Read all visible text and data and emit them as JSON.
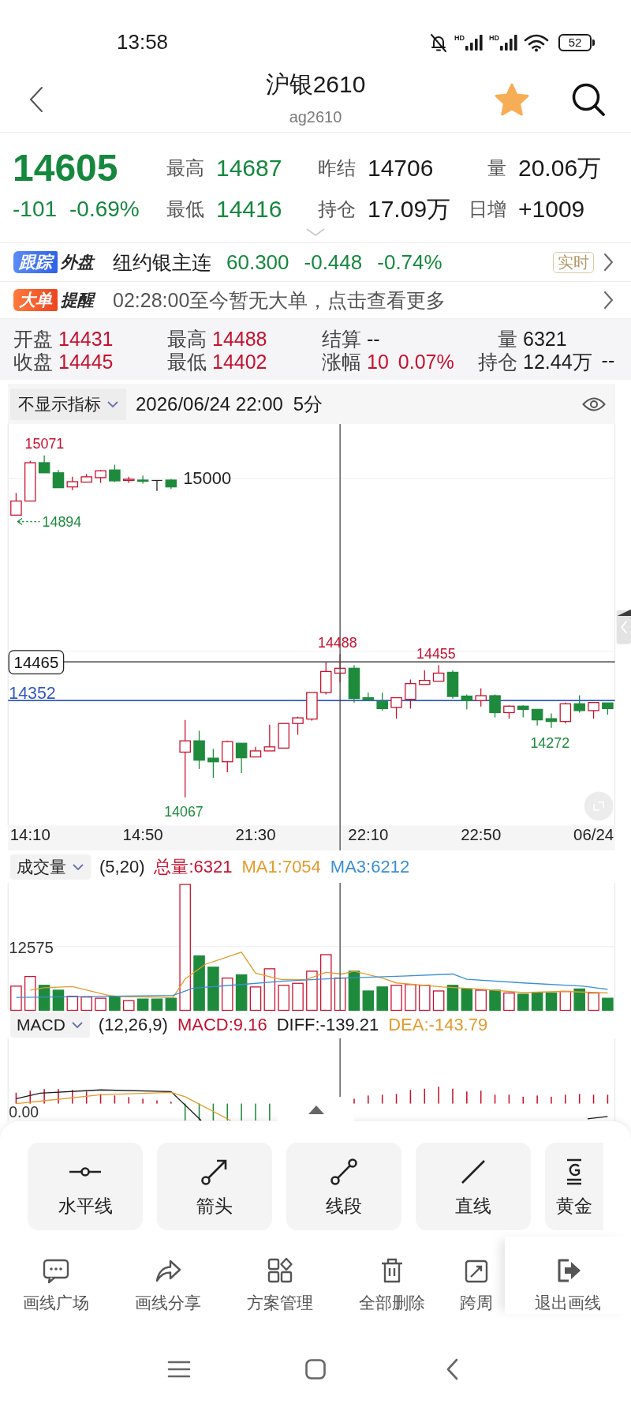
{
  "status_bar": {
    "time": "13:58",
    "network_labels": [
      "HD",
      "HD"
    ],
    "battery": "52"
  },
  "header": {
    "title": "沪银2610",
    "code": "ag2610",
    "favorite": true
  },
  "quote": {
    "last_price": "14605",
    "change": "-101",
    "change_percent": "-0.69%",
    "stats": [
      {
        "label": "最高",
        "value": "14687",
        "color": "#16883e"
      },
      {
        "label": "昨结",
        "value": "14706",
        "color": "#1a1a1a"
      },
      {
        "label": "量",
        "value": "20.06万",
        "color": "#1a1a1a"
      },
      {
        "label": "最低",
        "value": "14416",
        "color": "#16883e"
      },
      {
        "label": "持仓",
        "value": "17.09万",
        "color": "#1a1a1a"
      },
      {
        "label": "日增",
        "value": "+1009",
        "color": "#1a1a1a"
      }
    ]
  },
  "foreign_market": {
    "badge": "跟踪",
    "badge_label": "外盘",
    "name": "纽约银主连",
    "values": [
      "60.300",
      "-0.448",
      "-0.74%"
    ],
    "tag": "实时"
  },
  "big_order_alert": {
    "badge": "大单",
    "badge_label": "提醒",
    "message": "02:28:00至今暂无大单，点击查看更多"
  },
  "bar_info": {
    "rows": [
      [
        {
          "label": "开盘",
          "values": [
            {
              "text": "14431",
              "color": "#c8102e"
            }
          ]
        },
        {
          "label": "最高",
          "values": [
            {
              "text": "14488",
              "color": "#c8102e"
            }
          ]
        },
        {
          "label": "结算",
          "values": [
            {
              "text": "--",
              "color": "#1a1a1a"
            }
          ]
        },
        {
          "label": "量",
          "values": [
            {
              "text": "6321",
              "color": "#1a1a1a"
            }
          ]
        }
      ],
      [
        {
          "label": "收盘",
          "values": [
            {
              "text": "14445",
              "color": "#c8102e"
            }
          ]
        },
        {
          "label": "最低",
          "values": [
            {
              "text": "14402",
              "color": "#c8102e"
            }
          ]
        },
        {
          "label": "涨幅",
          "values": [
            {
              "text": "10",
              "color": "#c8102e"
            },
            {
              "text": "0.07%",
              "color": "#c8102e"
            }
          ]
        },
        {
          "label": "持仓",
          "values": [
            {
              "text": "12.44万",
              "color": "#1a1a1a"
            },
            {
              "text": "--",
              "color": "#1a1a1a"
            }
          ]
        }
      ]
    ]
  },
  "indicator_bar": {
    "selector": "不显示指标",
    "datetime": "2026/06/24 22:00",
    "period": "5分"
  },
  "price_chart": {
    "y_axis_labels": [
      "15000"
    ],
    "markers": [
      {
        "kind": "high",
        "text": "15071"
      },
      {
        "kind": "low_arrow",
        "text": "14894"
      },
      {
        "kind": "high",
        "text": "14488"
      },
      {
        "kind": "high",
        "text": "14455"
      },
      {
        "kind": "low",
        "text": "14272"
      },
      {
        "kind": "low",
        "text": "14067"
      }
    ],
    "current_price": "14465",
    "reference_price": "14352",
    "x_axis_labels": [
      "14:10",
      "14:50",
      "21:30",
      "22:10",
      "22:50",
      "06/24"
    ]
  },
  "volume": {
    "selector": "成交量",
    "params": "(5,20)",
    "values": [
      {
        "text": "总量:6321",
        "color": "#c8102e"
      },
      {
        "text": "MA1:7054",
        "color": "#e39b2d"
      },
      {
        "text": "MA3:6212",
        "color": "#3a8fd6"
      }
    ],
    "y_axis_label": "12575"
  },
  "macd": {
    "selector": "MACD",
    "params": "(12,26,9)",
    "values": [
      {
        "text": "MACD:9.16",
        "color": "#c8102e"
      },
      {
        "text": "DIFF:-139.21",
        "color": "#1a1a1a"
      },
      {
        "text": "DEA:-143.79",
        "color": "#e39b2d"
      }
    ],
    "y_axis_label": "0.00"
  },
  "drawing_tools": [
    {
      "kind": "horizontal_line",
      "label": "水平线"
    },
    {
      "kind": "arrow",
      "label": "箭头"
    },
    {
      "kind": "segment",
      "label": "线段"
    },
    {
      "kind": "line",
      "label": "直线"
    },
    {
      "kind": "ratio",
      "label": "黄金"
    }
  ],
  "drawing_actions": [
    {
      "kind": "square",
      "label": "画线广场"
    },
    {
      "kind": "share",
      "label": "画线分享"
    },
    {
      "kind": "plans",
      "label": "方案管理"
    },
    {
      "kind": "delete",
      "label": "全部删除"
    },
    {
      "kind": "cross_period",
      "label": "跨周"
    },
    {
      "kind": "exit",
      "label": "退出画线"
    }
  ]
}
